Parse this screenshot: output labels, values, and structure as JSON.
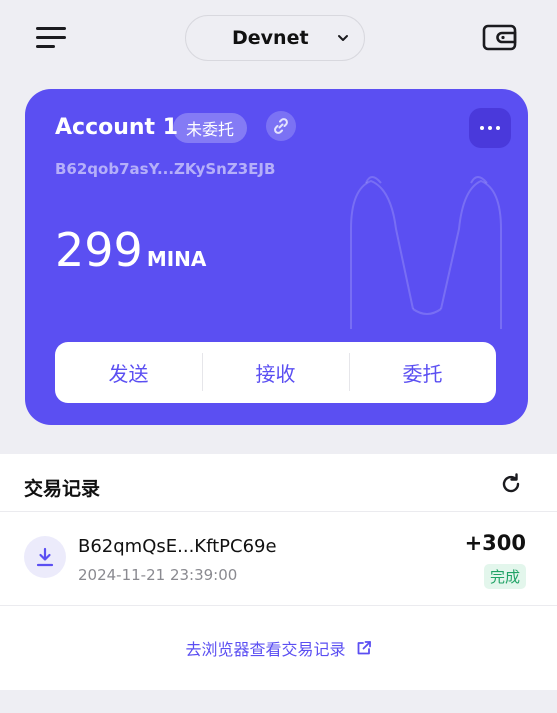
{
  "header": {
    "menu_icon": "menu-icon",
    "network": "Devnet",
    "wallet_icon": "wallet-icon"
  },
  "account": {
    "name": "Account 1",
    "delegation_status": "未委托",
    "address": "B62qob7asY...ZKySnZ3EJB",
    "balance": "299",
    "unit": "MINA",
    "actions": [
      "发送",
      "接收",
      "委托"
    ]
  },
  "transactions": {
    "title": "交易记录",
    "items": [
      {
        "address": "B62qmQsE...KftPC69e",
        "time": "2024-11-21 23:39:00",
        "amount": "+300",
        "status": "完成"
      }
    ],
    "explorer_link": "去浏览器查看交易记录"
  },
  "colors": {
    "accent": "#5b4ff2",
    "background": "#eeeef3",
    "success": "#21a366"
  }
}
